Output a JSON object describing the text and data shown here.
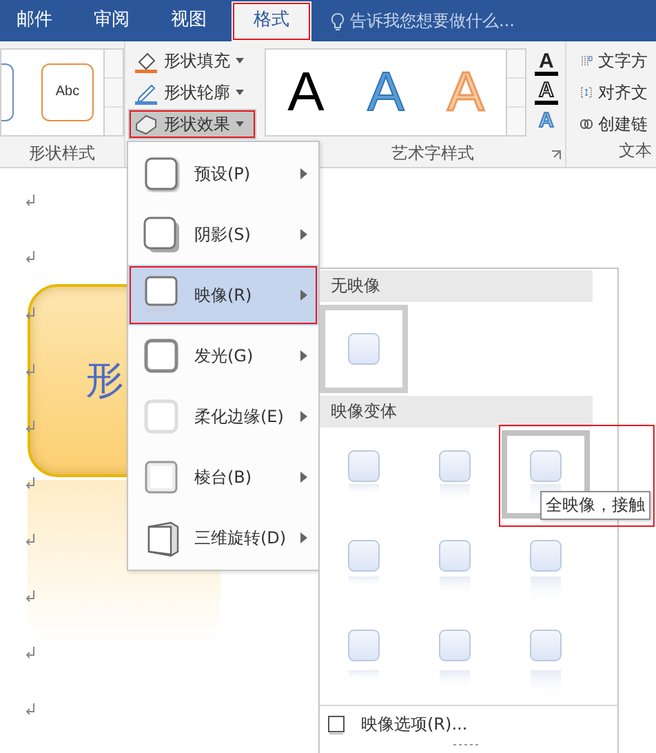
{
  "tabs": [
    {
      "label": "邮件",
      "selected": false,
      "annotated": false
    },
    {
      "label": "审阅",
      "selected": false,
      "annotated": false
    },
    {
      "label": "视图",
      "selected": false,
      "annotated": false
    },
    {
      "label": "格式",
      "selected": true,
      "annotated": true
    }
  ],
  "tell_me": {
    "placeholder": "告诉我您想要做什么..."
  },
  "ribbon": {
    "shape_styles": {
      "label": "形状样式",
      "samples": [
        {
          "text": "Abc"
        }
      ]
    },
    "shape_commands": [
      {
        "label": "形状填充",
        "kind": "fill",
        "pressed": false,
        "annotated": false
      },
      {
        "label": "形状轮廓",
        "kind": "outline",
        "pressed": false,
        "annotated": false
      },
      {
        "label": "形状效果",
        "kind": "effects",
        "pressed": true,
        "annotated": true
      }
    ],
    "wordart": {
      "label": "艺术字样式",
      "samples": [
        {
          "text": "A",
          "kind": "plain"
        },
        {
          "text": "A",
          "kind": "gradient"
        },
        {
          "text": "A",
          "kind": "outlined"
        }
      ],
      "text_buttons": [
        {
          "text": "A",
          "kind": "fill"
        },
        {
          "text": "A",
          "kind": "outline"
        },
        {
          "text": "A",
          "kind": "effects"
        }
      ]
    },
    "text": {
      "label": "文本",
      "commands": [
        {
          "label": "文字方",
          "kind": "direction"
        },
        {
          "label": "对齐文",
          "kind": "align"
        },
        {
          "label": "创建链",
          "kind": "link"
        }
      ]
    }
  },
  "document": {
    "shape": {
      "text": "形"
    }
  },
  "effects_menu": {
    "items": [
      {
        "label": "预设(P)",
        "kind": "preset",
        "selected": false,
        "annotated": false
      },
      {
        "label": "阴影(S)",
        "kind": "shadow",
        "selected": false,
        "annotated": false
      },
      {
        "label": "映像(R)",
        "kind": "reflection",
        "selected": true,
        "annotated": true
      },
      {
        "label": "发光(G)",
        "kind": "glow",
        "selected": false,
        "annotated": false
      },
      {
        "label": "柔化边缘(E)",
        "kind": "soft",
        "selected": false,
        "annotated": false
      },
      {
        "label": "棱台(B)",
        "kind": "bevel",
        "selected": false,
        "annotated": false
      },
      {
        "label": "三维旋转(D)",
        "kind": "rotation",
        "selected": false,
        "annotated": false
      }
    ]
  },
  "reflection_gallery": {
    "sections": [
      {
        "title": "无映像",
        "items": [
          {
            "kind": "none",
            "selected": true,
            "hovered": false
          }
        ]
      },
      {
        "title": "映像变体",
        "items": [
          {
            "kind": "variant",
            "selected": false,
            "hovered": false
          },
          {
            "kind": "variant",
            "selected": false,
            "hovered": false
          },
          {
            "kind": "variant",
            "selected": false,
            "hovered": true
          },
          {
            "kind": "variant",
            "selected": false,
            "hovered": false
          },
          {
            "kind": "variant",
            "selected": false,
            "hovered": false
          },
          {
            "kind": "variant",
            "selected": false,
            "hovered": false
          },
          {
            "kind": "variant",
            "selected": false,
            "hovered": false
          },
          {
            "kind": "variant",
            "selected": false,
            "hovered": false
          },
          {
            "kind": "variant",
            "selected": false,
            "hovered": false
          }
        ]
      }
    ],
    "tooltip": "全映像，接触",
    "tooltip_annotated": true,
    "options": "映像选项(R)..."
  }
}
